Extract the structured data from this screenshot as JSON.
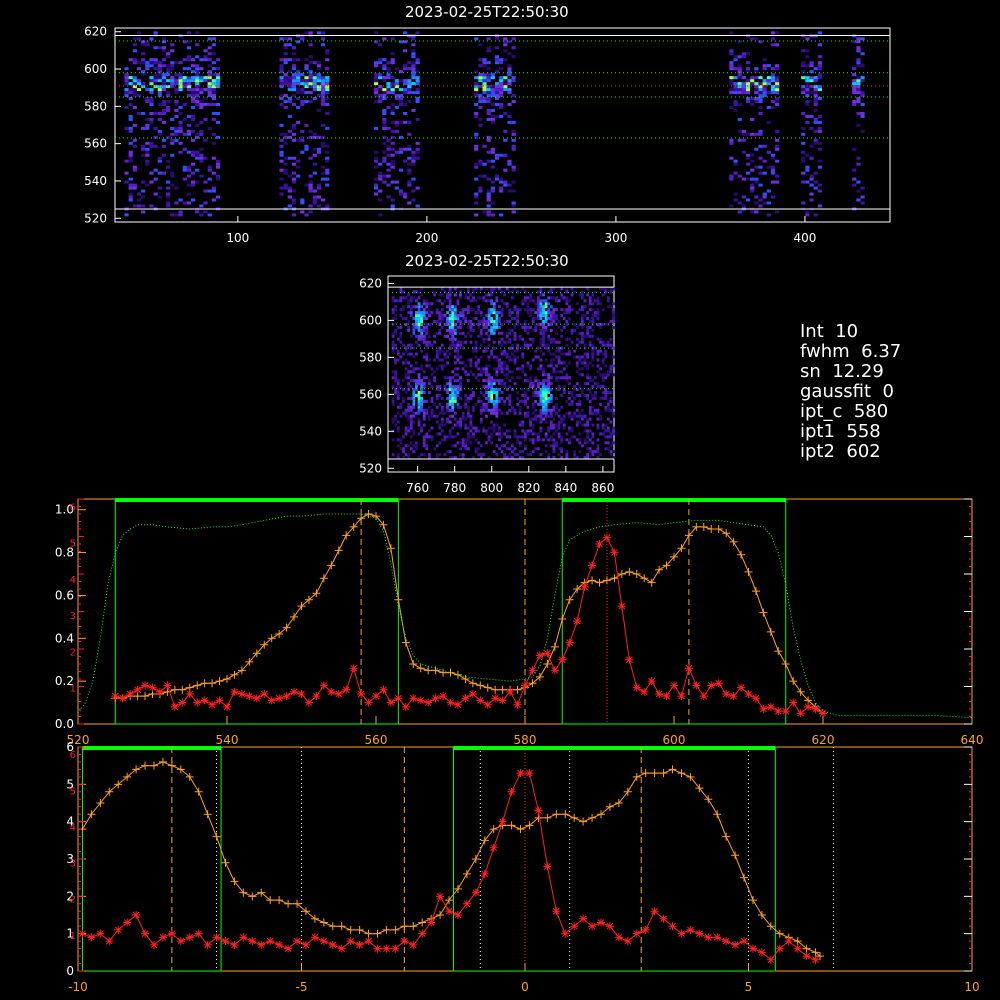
{
  "titles": {
    "top": "2023-02-25T22:50:30",
    "mid": "2023-02-25T22:50:30"
  },
  "info": [
    {
      "label": "Int",
      "value": "10"
    },
    {
      "label": "fwhm",
      "value": "6.37"
    },
    {
      "label": "sn",
      "value": "12.29"
    },
    {
      "label": "gaussfit",
      "value": "0"
    },
    {
      "label": "ipt_c",
      "value": "580"
    },
    {
      "label": "ipt1",
      "value": "558"
    },
    {
      "label": "ipt2",
      "value": "602"
    }
  ],
  "colors": {
    "orange": "#ffa020",
    "red": "#ff2020",
    "green": "#00ff00",
    "white": "#ffffff"
  },
  "chart_data": [
    {
      "type": "heatmap",
      "title": "2023-02-25T22:50:30",
      "xlim": [
        35,
        445
      ],
      "ylim": [
        518,
        622
      ],
      "xticks": [
        100,
        200,
        300,
        400
      ],
      "yticks": [
        520,
        540,
        560,
        580,
        600,
        620
      ],
      "column_bands": [
        [
          40,
          90
        ],
        [
          122,
          148
        ],
        [
          172,
          196
        ],
        [
          225,
          245
        ],
        [
          360,
          385
        ],
        [
          398,
          408
        ],
        [
          425,
          430
        ]
      ],
      "hlines_white": [
        525,
        618
      ],
      "hlines_green": [
        563,
        585,
        598,
        615
      ],
      "hline_red": 591
    },
    {
      "type": "heatmap",
      "title": "2023-02-25T22:50:30",
      "xlim": [
        744,
        866
      ],
      "ylim": [
        518,
        624
      ],
      "xticks": [
        760,
        780,
        800,
        820,
        840,
        860
      ],
      "yticks": [
        520,
        540,
        560,
        580,
        600,
        620
      ],
      "hlines_white": [
        525,
        618
      ],
      "hlines_green": [
        563,
        585,
        598,
        615
      ],
      "spots": [
        [
          760,
          600
        ],
        [
          778,
          600
        ],
        [
          800,
          600
        ],
        [
          828,
          605
        ],
        [
          760,
          558
        ],
        [
          778,
          558
        ],
        [
          800,
          558
        ],
        [
          828,
          558
        ]
      ]
    },
    {
      "type": "line",
      "xlim": [
        520,
        640
      ],
      "ylim": [
        0,
        1.05
      ],
      "xticks": [
        520,
        540,
        560,
        580,
        600,
        620,
        640
      ],
      "yticks": [
        0.0,
        0.2,
        0.4,
        0.6,
        0.8,
        1.0
      ],
      "ytick_labels": [
        "0.0",
        "0.2",
        "0.4",
        "0.6",
        "0.8",
        "1.0"
      ],
      "right_ticks": [
        "1",
        "2",
        "3",
        "4",
        "5",
        "6"
      ],
      "vlines_orange": [
        558,
        580,
        602
      ],
      "vline_red": 591,
      "green_boxes": [
        [
          525,
          563
        ],
        [
          585,
          615
        ]
      ],
      "series": [
        {
          "color": "orange",
          "x": [
            525,
            526,
            527,
            528,
            529,
            530,
            531,
            532,
            533,
            534,
            535,
            536,
            537,
            538,
            539,
            540,
            541,
            542,
            543,
            544,
            545,
            546,
            547,
            548,
            549,
            550,
            551,
            552,
            553,
            554,
            555,
            556,
            557,
            558,
            559,
            560,
            561,
            562,
            563,
            564,
            565,
            566,
            567,
            568,
            569,
            570,
            571,
            572,
            573,
            574,
            575,
            576,
            577,
            578,
            579,
            580,
            581,
            582,
            583,
            584,
            585,
            586,
            587,
            588,
            589,
            590,
            591,
            592,
            593,
            594,
            595,
            596,
            597,
            598,
            599,
            600,
            601,
            602,
            603,
            604,
            605,
            606,
            607,
            608,
            609,
            610,
            611,
            612,
            613,
            614,
            615,
            616,
            617,
            618,
            619,
            620
          ],
          "y": [
            0.12,
            0.12,
            0.13,
            0.13,
            0.13,
            0.14,
            0.14,
            0.15,
            0.16,
            0.16,
            0.17,
            0.18,
            0.19,
            0.19,
            0.2,
            0.21,
            0.23,
            0.25,
            0.29,
            0.33,
            0.37,
            0.4,
            0.42,
            0.45,
            0.5,
            0.55,
            0.58,
            0.61,
            0.68,
            0.74,
            0.81,
            0.88,
            0.92,
            0.96,
            0.98,
            0.97,
            0.93,
            0.82,
            0.58,
            0.38,
            0.28,
            0.26,
            0.25,
            0.25,
            0.24,
            0.24,
            0.23,
            0.21,
            0.19,
            0.18,
            0.17,
            0.16,
            0.16,
            0.16,
            0.16,
            0.17,
            0.19,
            0.22,
            0.28,
            0.36,
            0.49,
            0.58,
            0.63,
            0.66,
            0.67,
            0.66,
            0.67,
            0.68,
            0.7,
            0.71,
            0.7,
            0.68,
            0.66,
            0.72,
            0.74,
            0.78,
            0.82,
            0.88,
            0.92,
            0.92,
            0.91,
            0.91,
            0.89,
            0.85,
            0.79,
            0.71,
            0.62,
            0.52,
            0.43,
            0.34,
            0.28,
            0.2,
            0.15,
            0.11,
            0.08,
            0.05
          ]
        },
        {
          "color": "red",
          "x": [
            525,
            526,
            527,
            528,
            529,
            530,
            531,
            532,
            533,
            534,
            535,
            536,
            537,
            538,
            539,
            540,
            541,
            542,
            543,
            544,
            545,
            546,
            547,
            548,
            549,
            550,
            551,
            552,
            553,
            554,
            555,
            556,
            557,
            558,
            559,
            560,
            561,
            562,
            563,
            564,
            565,
            566,
            567,
            568,
            569,
            570,
            571,
            572,
            573,
            574,
            575,
            576,
            577,
            578,
            579,
            580,
            581,
            582,
            583,
            584,
            585,
            586,
            587,
            588,
            589,
            590,
            591,
            592,
            593,
            594,
            595,
            596,
            597,
            598,
            599,
            600,
            601,
            602,
            603,
            604,
            605,
            606,
            607,
            608,
            609,
            610,
            611,
            612,
            613,
            614,
            615,
            616,
            617,
            618,
            619,
            620
          ],
          "y": [
            0.13,
            0.12,
            0.14,
            0.16,
            0.18,
            0.17,
            0.15,
            0.18,
            0.08,
            0.1,
            0.14,
            0.1,
            0.11,
            0.09,
            0.11,
            0.08,
            0.15,
            0.14,
            0.13,
            0.12,
            0.14,
            0.11,
            0.12,
            0.13,
            0.15,
            0.14,
            0.1,
            0.13,
            0.18,
            0.15,
            0.14,
            0.16,
            0.26,
            0.14,
            0.1,
            0.13,
            0.16,
            0.1,
            0.12,
            0.08,
            0.12,
            0.11,
            0.1,
            0.12,
            0.13,
            0.1,
            0.09,
            0.12,
            0.14,
            0.11,
            0.09,
            0.12,
            0.11,
            0.15,
            0.09,
            0.18,
            0.25,
            0.32,
            0.33,
            0.25,
            0.3,
            0.38,
            0.48,
            0.64,
            0.74,
            0.84,
            0.87,
            0.8,
            0.55,
            0.3,
            0.17,
            0.15,
            0.2,
            0.14,
            0.13,
            0.18,
            0.13,
            0.26,
            0.18,
            0.13,
            0.18,
            0.19,
            0.14,
            0.13,
            0.17,
            0.14,
            0.12,
            0.07,
            0.08,
            0.06,
            0.06,
            0.1,
            0.05,
            0.08,
            0.07,
            0.05
          ]
        },
        {
          "color": "green",
          "style": "dotted",
          "x": [
            520,
            521,
            522,
            523,
            524,
            525,
            526,
            527,
            528,
            530,
            532,
            535,
            538,
            540,
            542,
            545,
            548,
            550,
            553,
            556,
            558,
            560,
            561,
            562,
            563,
            564,
            565,
            566,
            568,
            570,
            572,
            575,
            578,
            580,
            581,
            582,
            583,
            584,
            585,
            586,
            588,
            590,
            592,
            595,
            598,
            600,
            603,
            606,
            608,
            610,
            612,
            613,
            614,
            615,
            616,
            617,
            618,
            619,
            620,
            622,
            625,
            630,
            635,
            640
          ],
          "y": [
            0.05,
            0.1,
            0.2,
            0.4,
            0.65,
            0.8,
            0.88,
            0.91,
            0.93,
            0.93,
            0.92,
            0.91,
            0.92,
            0.92,
            0.93,
            0.95,
            0.97,
            0.97,
            0.98,
            0.98,
            0.98,
            0.96,
            0.9,
            0.75,
            0.55,
            0.4,
            0.32,
            0.28,
            0.26,
            0.24,
            0.22,
            0.21,
            0.2,
            0.21,
            0.22,
            0.27,
            0.4,
            0.6,
            0.78,
            0.86,
            0.9,
            0.92,
            0.93,
            0.94,
            0.93,
            0.94,
            0.95,
            0.95,
            0.94,
            0.93,
            0.92,
            0.88,
            0.8,
            0.65,
            0.45,
            0.3,
            0.18,
            0.1,
            0.06,
            0.04,
            0.04,
            0.04,
            0.04,
            0.03
          ]
        }
      ]
    },
    {
      "type": "line",
      "xlim": [
        -10,
        10
      ],
      "ylim": [
        0,
        6
      ],
      "xticks": [
        -10,
        -5,
        0,
        5,
        10
      ],
      "yticks": [
        0,
        1,
        2,
        3,
        4,
        5,
        6
      ],
      "right_ticks": [
        "1",
        "2",
        "3",
        "4",
        "5",
        "6"
      ],
      "vlines_orange": [
        -7.9,
        -2.7,
        2.6
      ],
      "vline_red": 0,
      "vlines_white_dotted": [
        -6.9,
        -5.0,
        -1.0,
        1.0,
        5.0,
        6.9
      ],
      "green_boxes": [
        [
          -9.9,
          -6.8
        ],
        [
          -1.6,
          5.6
        ]
      ],
      "series": [
        {
          "color": "orange",
          "x": [
            -9.9,
            -9.7,
            -9.5,
            -9.3,
            -9.1,
            -8.9,
            -8.7,
            -8.5,
            -8.3,
            -8.1,
            -7.9,
            -7.7,
            -7.5,
            -7.3,
            -7.1,
            -6.9,
            -6.7,
            -6.5,
            -6.3,
            -6.1,
            -5.9,
            -5.7,
            -5.5,
            -5.3,
            -5.1,
            -4.9,
            -4.7,
            -4.5,
            -4.3,
            -4.1,
            -3.9,
            -3.7,
            -3.5,
            -3.3,
            -3.1,
            -2.9,
            -2.7,
            -2.5,
            -2.3,
            -2.1,
            -1.9,
            -1.7,
            -1.5,
            -1.3,
            -1.1,
            -0.9,
            -0.7,
            -0.5,
            -0.3,
            -0.1,
            0.1,
            0.3,
            0.5,
            0.7,
            0.9,
            1.1,
            1.3,
            1.5,
            1.7,
            1.9,
            2.1,
            2.3,
            2.5,
            2.7,
            2.9,
            3.1,
            3.3,
            3.5,
            3.7,
            3.9,
            4.1,
            4.3,
            4.5,
            4.7,
            4.9,
            5.1,
            5.3,
            5.5,
            5.7,
            5.9,
            6.1,
            6.3,
            6.5,
            6.6
          ],
          "y": [
            3.8,
            4.2,
            4.5,
            4.8,
            5.0,
            5.2,
            5.4,
            5.5,
            5.5,
            5.6,
            5.5,
            5.4,
            5.2,
            4.8,
            4.2,
            3.6,
            2.9,
            2.4,
            2.1,
            2.0,
            2.1,
            1.9,
            1.9,
            1.8,
            1.8,
            1.6,
            1.4,
            1.3,
            1.2,
            1.2,
            1.1,
            1.1,
            1.0,
            1.0,
            1.1,
            1.1,
            1.2,
            1.2,
            1.3,
            1.4,
            1.5,
            1.9,
            2.2,
            2.6,
            3.0,
            3.5,
            3.8,
            3.9,
            3.9,
            3.8,
            3.9,
            4.1,
            4.1,
            4.2,
            4.2,
            4.1,
            4.0,
            4.1,
            4.2,
            4.4,
            4.5,
            4.8,
            5.2,
            5.3,
            5.3,
            5.3,
            5.4,
            5.3,
            5.2,
            4.9,
            4.6,
            4.2,
            3.6,
            3.1,
            2.5,
            1.9,
            1.5,
            1.2,
            1.0,
            0.9,
            0.8,
            0.6,
            0.5,
            0.4
          ]
        },
        {
          "color": "red",
          "x": [
            -9.9,
            -9.7,
            -9.5,
            -9.3,
            -9.1,
            -8.9,
            -8.7,
            -8.5,
            -8.3,
            -8.1,
            -7.9,
            -7.7,
            -7.5,
            -7.3,
            -7.1,
            -6.9,
            -6.7,
            -6.5,
            -6.3,
            -6.1,
            -5.9,
            -5.7,
            -5.5,
            -5.3,
            -5.1,
            -4.9,
            -4.7,
            -4.5,
            -4.3,
            -4.1,
            -3.9,
            -3.7,
            -3.5,
            -3.3,
            -3.1,
            -2.9,
            -2.7,
            -2.5,
            -2.3,
            -2.1,
            -1.9,
            -1.7,
            -1.5,
            -1.3,
            -1.1,
            -0.9,
            -0.7,
            -0.5,
            -0.3,
            -0.1,
            0.1,
            0.3,
            0.5,
            0.7,
            0.9,
            1.1,
            1.3,
            1.5,
            1.7,
            1.9,
            2.1,
            2.3,
            2.5,
            2.7,
            2.9,
            3.1,
            3.3,
            3.5,
            3.7,
            3.9,
            4.1,
            4.3,
            4.5,
            4.7,
            4.9,
            5.1,
            5.3,
            5.5,
            5.7,
            5.9,
            6.1,
            6.3,
            6.5
          ],
          "y": [
            1.0,
            0.9,
            1.0,
            0.8,
            1.1,
            1.3,
            1.5,
            1.0,
            0.7,
            0.9,
            1.0,
            0.8,
            0.9,
            1.0,
            0.7,
            0.9,
            0.8,
            0.7,
            0.9,
            0.8,
            0.7,
            0.8,
            0.7,
            0.6,
            0.8,
            0.7,
            0.9,
            0.8,
            0.7,
            0.6,
            0.8,
            0.7,
            0.8,
            0.6,
            0.6,
            0.6,
            0.8,
            0.7,
            1.0,
            1.3,
            2.0,
            1.6,
            1.5,
            1.8,
            2.1,
            2.6,
            3.3,
            4.0,
            4.8,
            5.3,
            5.3,
            4.3,
            2.8,
            1.6,
            1.0,
            1.2,
            1.4,
            1.2,
            1.3,
            1.2,
            0.9,
            0.8,
            1.0,
            1.1,
            1.6,
            1.4,
            1.2,
            1.0,
            1.1,
            1.0,
            0.9,
            0.9,
            0.8,
            0.7,
            0.8,
            0.6,
            0.5,
            0.3,
            0.6,
            0.8,
            0.6,
            0.4,
            0.3
          ]
        }
      ]
    }
  ]
}
